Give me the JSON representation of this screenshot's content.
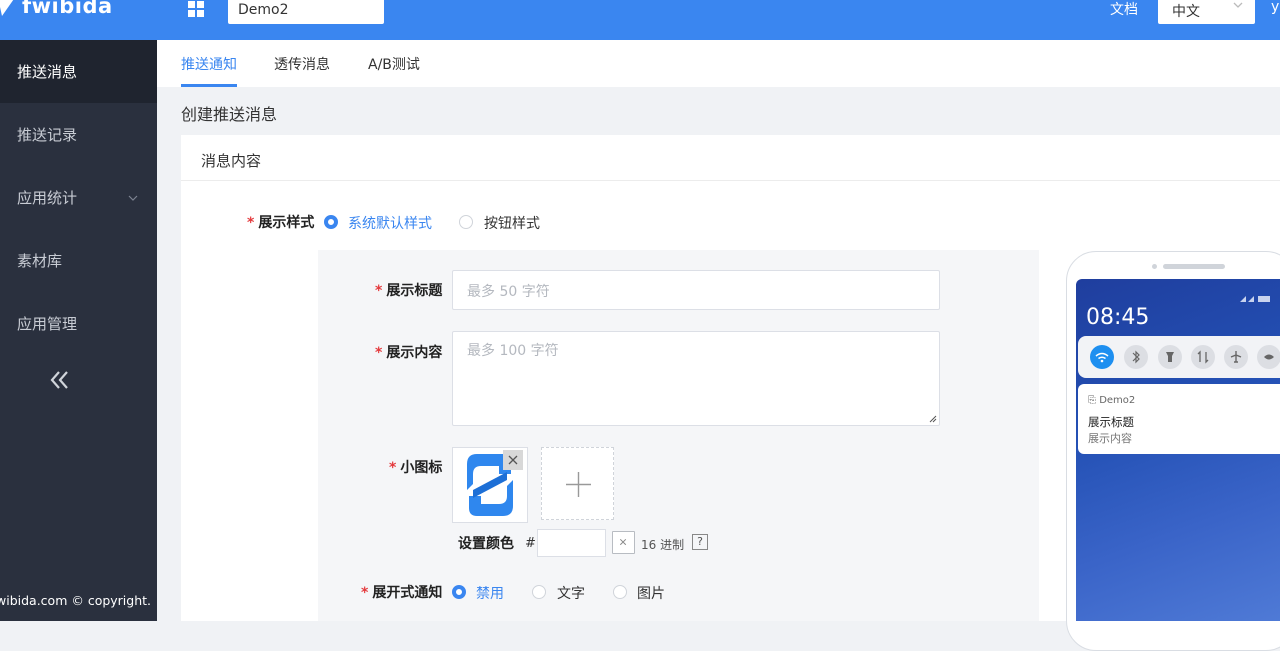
{
  "brand": {
    "name": "fwibida",
    "accent": "#3a86f0"
  },
  "header": {
    "app_selector": "Demo2",
    "docs_label": "文档",
    "language": "中文",
    "user_initial": "y"
  },
  "sidebar": {
    "items": [
      {
        "label": "推送消息",
        "active": true
      },
      {
        "label": "推送记录"
      },
      {
        "label": "应用统计",
        "has_submenu": true
      },
      {
        "label": "素材库"
      },
      {
        "label": "应用管理"
      }
    ],
    "collapse_icon": "double-chevron-left-icon",
    "copyright": "wibida.com © copyright."
  },
  "tabs": [
    {
      "label": "推送通知",
      "active": true
    },
    {
      "label": "透传消息"
    },
    {
      "label": "A/B测试"
    }
  ],
  "page_title": "创建推送消息",
  "card_title": "消息内容",
  "form": {
    "display_style": {
      "label": "展示样式",
      "options": [
        {
          "label": "系统默认样式",
          "selected": true
        },
        {
          "label": "按钮样式",
          "selected": false
        }
      ]
    },
    "title": {
      "label": "展示标题",
      "placeholder": "最多 50 字符",
      "value": ""
    },
    "content": {
      "label": "展示内容",
      "placeholder": "最多 100 字符",
      "value": ""
    },
    "small_icon": {
      "label": "小图标"
    },
    "color": {
      "label": "设置颜色",
      "prefix": "#",
      "value": "",
      "hint": "16 进制",
      "help": "?"
    },
    "expand": {
      "label": "展开式通知",
      "options": [
        {
          "label": "禁用",
          "selected": true
        },
        {
          "label": "文字",
          "selected": false
        },
        {
          "label": "图片",
          "selected": false
        }
      ]
    }
  },
  "preview": {
    "time": "08:45",
    "notification": {
      "app": "Demo2",
      "title": "展示标题",
      "body": "展示内容"
    },
    "quick_settings": [
      "wifi-icon",
      "bluetooth-icon",
      "flashlight-icon",
      "data-icon",
      "airplane-icon",
      "eye-icon"
    ]
  }
}
